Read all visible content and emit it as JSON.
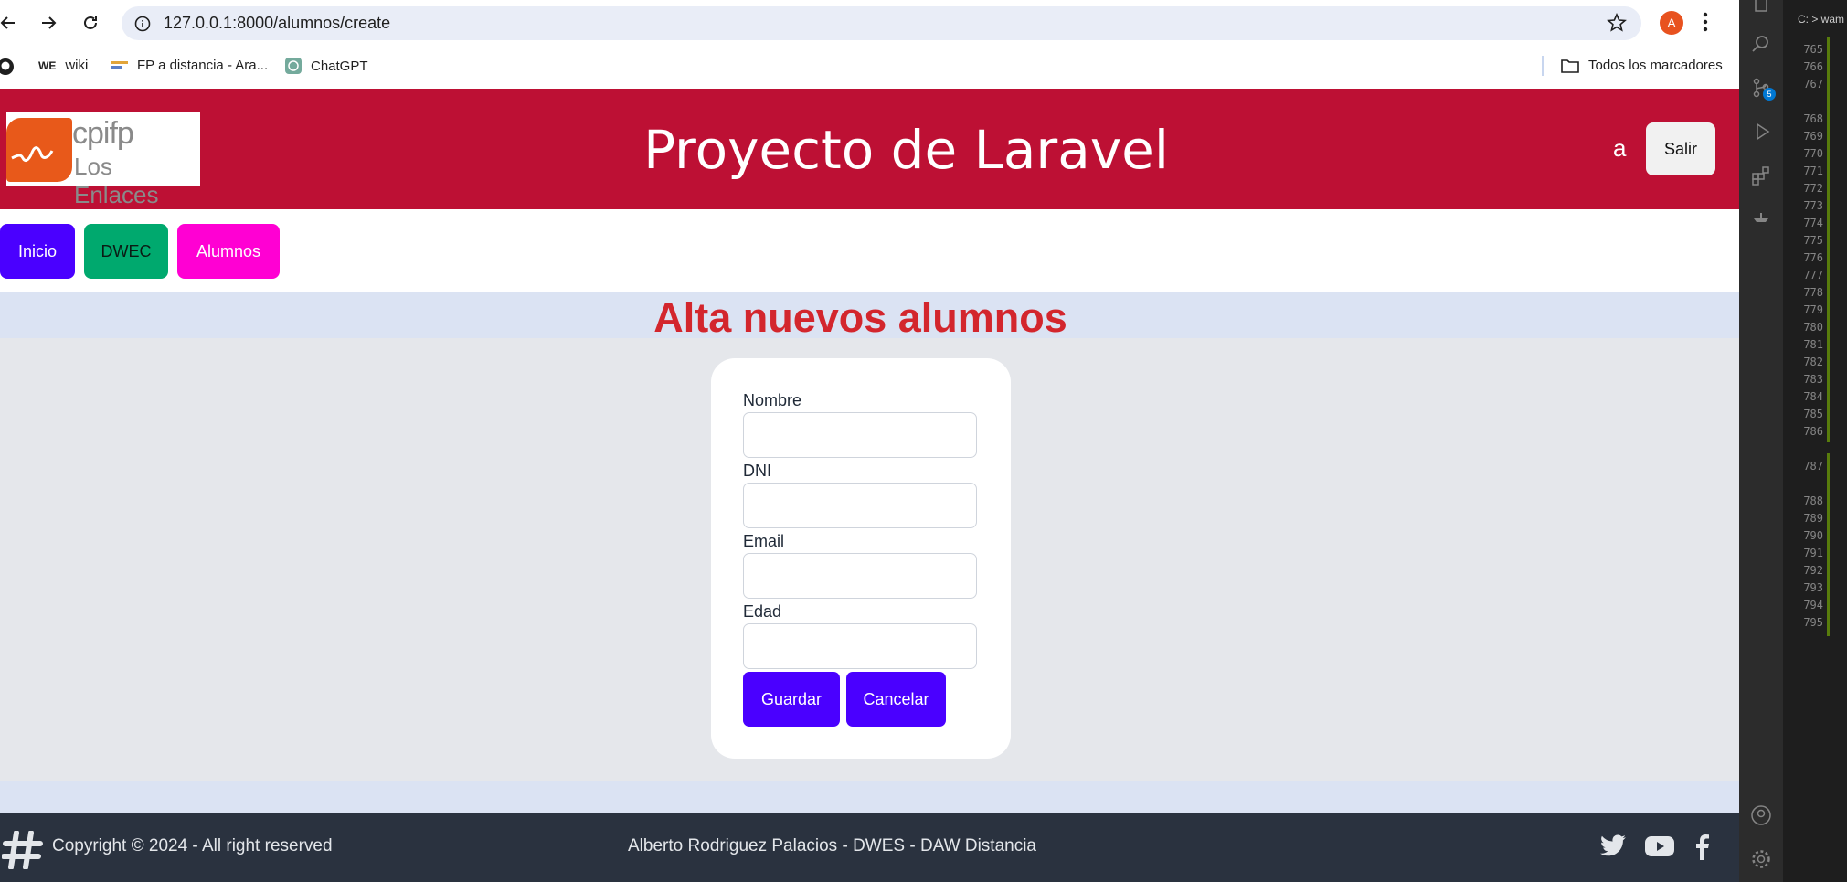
{
  "browser": {
    "url": "127.0.0.1:8000/alumnos/create",
    "profile_initial": "A",
    "bookmarks": [
      {
        "label": "wiki",
        "icon": "wiki-icon"
      },
      {
        "label": "FP a distancia - Ara...",
        "icon": "fp-icon"
      },
      {
        "label": "ChatGPT",
        "icon": "chatgpt-icon"
      }
    ],
    "all_bookmarks_label": "Todos los marcadores"
  },
  "header": {
    "logo_top": "cpifp",
    "logo_bottom": "Los Enlaces",
    "title": "Proyecto de Laravel",
    "user": "a",
    "logout_label": "Salir",
    "color": "#bd1034"
  },
  "nav": [
    {
      "label": "Inicio",
      "color": "#4a00ff",
      "text_color": "#ffffff"
    },
    {
      "label": "DWEC",
      "color": "#00a96e",
      "text_color": "#0b1b14"
    },
    {
      "label": "Alumnos",
      "color": "#ff00d3",
      "text_color": "#ffffff"
    }
  ],
  "page": {
    "subtitle": "Alta nuevos alumnos"
  },
  "form": {
    "fields": [
      {
        "label": "Nombre",
        "value": ""
      },
      {
        "label": "DNI",
        "value": ""
      },
      {
        "label": "Email",
        "value": ""
      },
      {
        "label": "Edad",
        "value": ""
      }
    ],
    "save_label": "Guardar",
    "cancel_label": "Cancelar"
  },
  "footer": {
    "copyright": "Copyright © 2024 - All right reserved",
    "credits": "Alberto Rodriguez Palacios - DWES - DAW Distancia",
    "social": [
      "twitter-icon",
      "youtube-icon",
      "facebook-icon"
    ]
  },
  "editor": {
    "path": "C: > wam",
    "badge": "5",
    "line_numbers": [
      "765",
      "766",
      "767",
      "768",
      "769",
      "770",
      "771",
      "772",
      "773",
      "774",
      "775",
      "776",
      "777",
      "778",
      "779",
      "780",
      "781",
      "782",
      "783",
      "784",
      "785",
      "786",
      "787",
      "788",
      "789",
      "790",
      "791",
      "792",
      "793",
      "794",
      "795"
    ]
  }
}
